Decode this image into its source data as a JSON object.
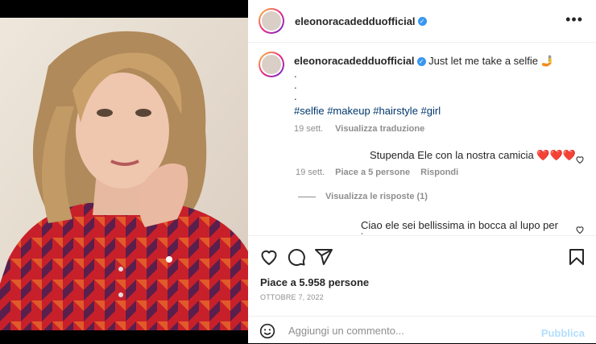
{
  "post": {
    "username": "eleonoracadedduofficial",
    "verified_icon": "check",
    "caption_text": "Just let me take a selfie",
    "caption_emoji": "🤳",
    "caption_dots": [
      ".",
      ".",
      "."
    ],
    "hashtags": "#selfie #makeup #hairstyle #girl",
    "caption_age": "19 sett.",
    "translate_label": "Visualizza traduzione"
  },
  "comments": [
    {
      "text": "Stupenda Ele con la nostra camicia ❤️❤️❤️",
      "age": "19 sett.",
      "likes_label": "Piace a 5 persone",
      "reply_label": "Rispondi",
      "replies_label": "Visualizza le risposte (1)"
    },
    {
      "text": "Ciao ele sei bellissima in bocca al lupo per i"
    }
  ],
  "likes": "Piace a 5.958 persone",
  "date": "OTTOBRE 7, 2022",
  "add_comment": {
    "placeholder": "Aggiungi un commento...",
    "publish_label": "Pubblica"
  },
  "colors": {
    "link": "#00376b",
    "verified": "#3897f0",
    "publish_disabled": "#b2dffc",
    "shirt_red": "#c8202a",
    "shirt_purple": "#5a1f4c"
  }
}
